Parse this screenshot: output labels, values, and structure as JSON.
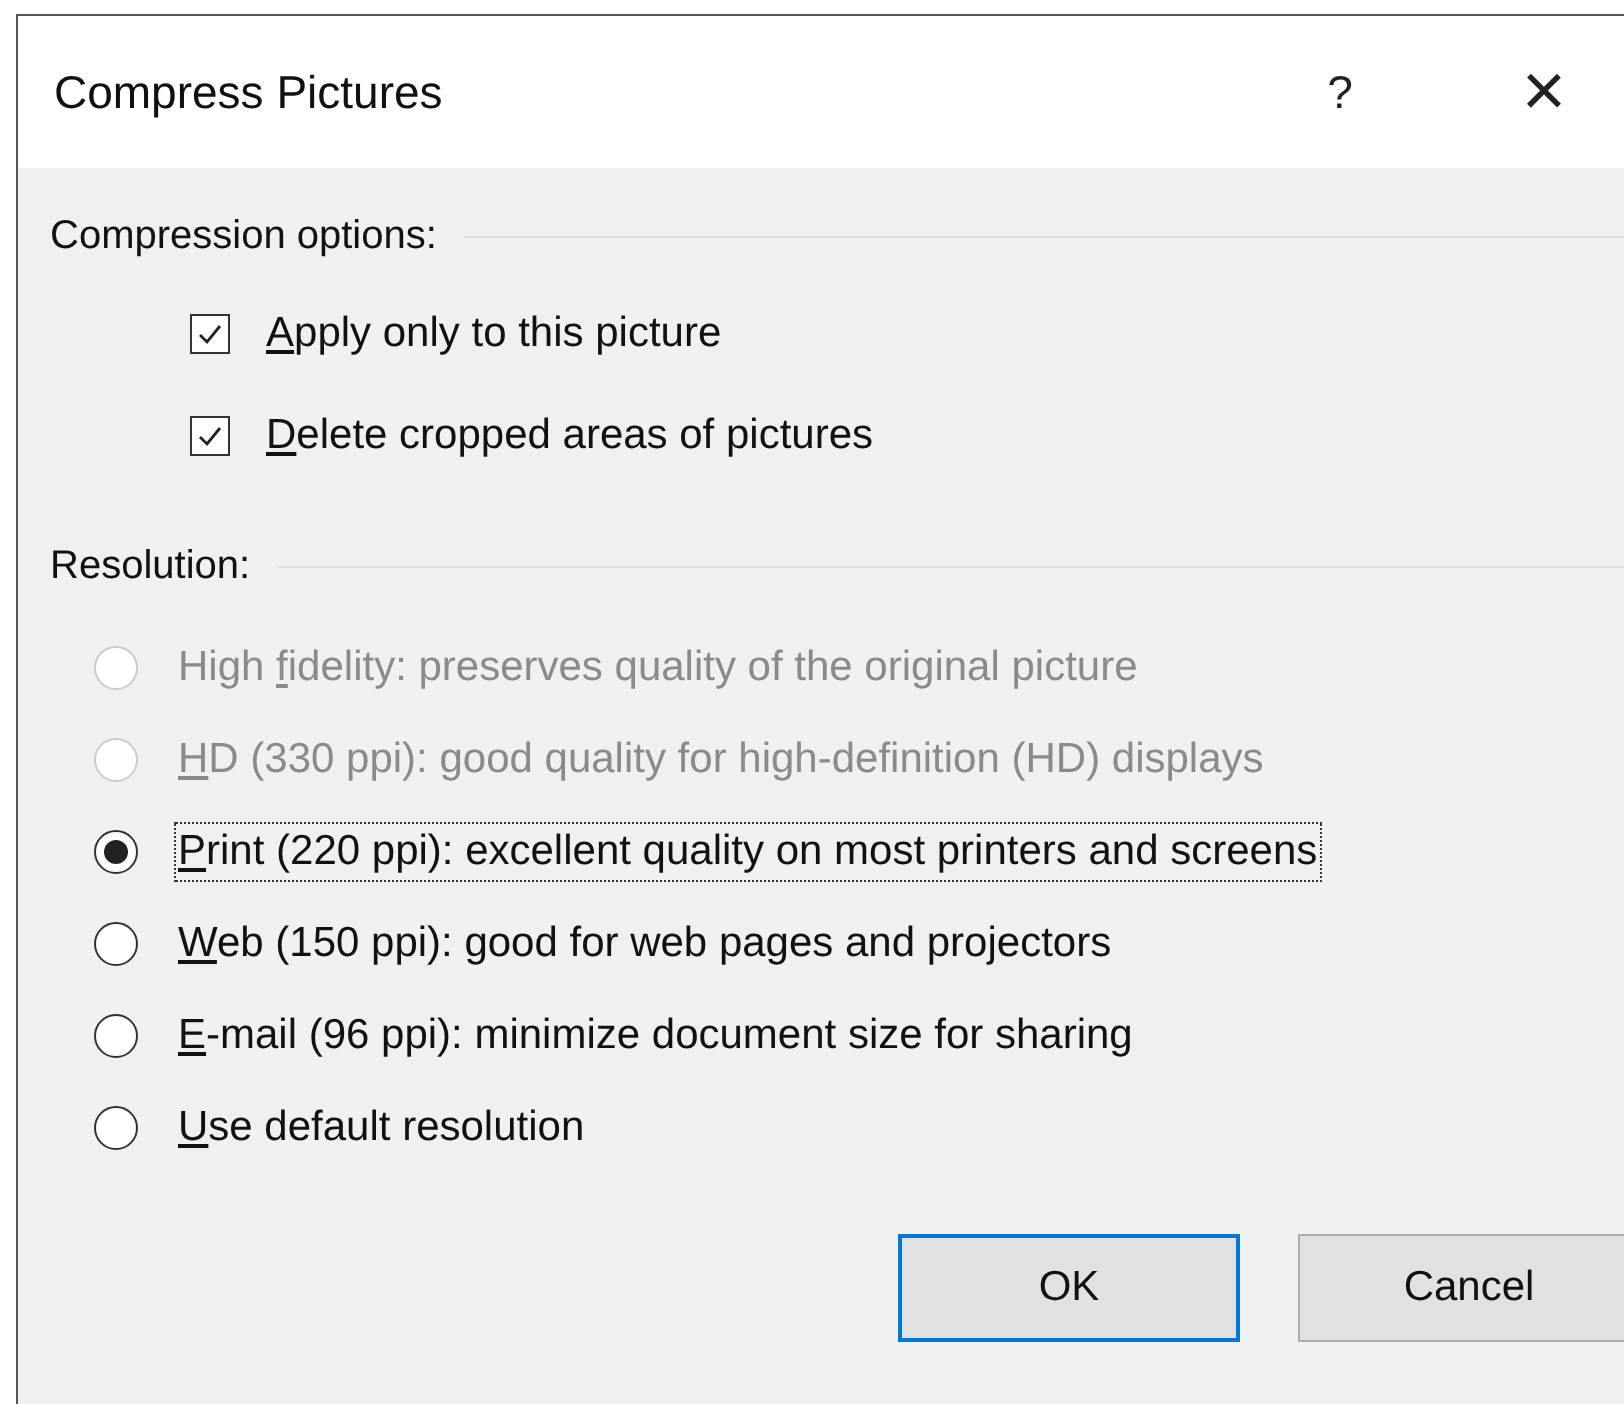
{
  "window": {
    "title": "Compress Pictures",
    "help": "?",
    "close": "×"
  },
  "compression": {
    "heading": "Compression options:",
    "options": [
      {
        "key": "A",
        "post": "pply only to this picture",
        "checked": true
      },
      {
        "key": "D",
        "post": "elete cropped areas of pictures",
        "checked": true
      }
    ]
  },
  "resolution": {
    "heading": "Resolution:",
    "options": [
      {
        "pre": "High ",
        "key": "f",
        "post": "idelity: preserves quality of the original picture",
        "selected": false,
        "disabled": true,
        "focused": false
      },
      {
        "key": "H",
        "post": "D (330 ppi): good quality for high-definition (HD) displays",
        "selected": false,
        "disabled": true,
        "focused": false
      },
      {
        "key": "P",
        "post": "rint (220 ppi): excellent quality on most printers and screens",
        "selected": true,
        "disabled": false,
        "focused": true
      },
      {
        "key": "W",
        "post": "eb (150 ppi): good for web pages and projectors",
        "selected": false,
        "disabled": false,
        "focused": false
      },
      {
        "key": "E",
        "post": "-mail (96 ppi): minimize document size for sharing",
        "selected": false,
        "disabled": false,
        "focused": false
      },
      {
        "key": "U",
        "post": "se default resolution",
        "selected": false,
        "disabled": false,
        "focused": false
      }
    ]
  },
  "buttons": [
    {
      "label": "OK",
      "default": true
    },
    {
      "label": "Cancel",
      "default": false
    }
  ]
}
